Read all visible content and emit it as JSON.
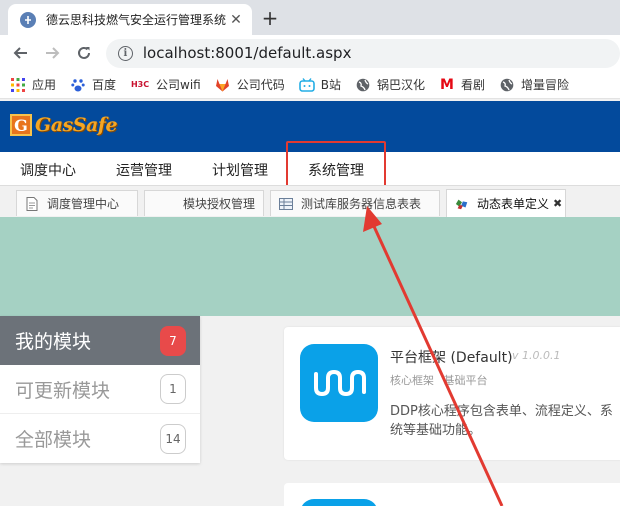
{
  "browser": {
    "tab_title": "德云思科技燃气安全运行管理系统",
    "url": "localhost:8001/default.aspx"
  },
  "bookmarks": [
    {
      "label": "应用",
      "icon": "apps-grid-icon"
    },
    {
      "label": "百度",
      "icon": "baidu-paw-icon"
    },
    {
      "label": "公司wifi",
      "icon": "h3c-logo-icon",
      "icon_text": "H3C"
    },
    {
      "label": "公司代码",
      "icon": "gitlab-icon"
    },
    {
      "label": "B站",
      "icon": "bilibili-tv-icon"
    },
    {
      "label": "锅巴汉化",
      "icon": "globe-icon"
    },
    {
      "label": "看剧",
      "icon": "m-logo-icon",
      "icon_text": "M"
    },
    {
      "label": "增量冒险",
      "icon": "globe-icon"
    }
  ],
  "app": {
    "logo_letter": "G",
    "logo_text": "GasSafe"
  },
  "main_menu": [
    "调度中心",
    "运营管理",
    "计划管理",
    "系统管理"
  ],
  "sub_tabs": [
    {
      "label": "调度管理中心"
    },
    {
      "label": "模块授权管理"
    },
    {
      "label": "测试库服务器信息表表"
    },
    {
      "label": "动态表单定义",
      "close": "✖"
    }
  ],
  "side_menu": [
    {
      "label": "我的模块",
      "count": "7"
    },
    {
      "label": "可更新模块",
      "count": "1"
    },
    {
      "label": "全部模块",
      "count": "14"
    }
  ],
  "module_card": {
    "title": "平台框架 (Default)",
    "version": "v 1.0.0.1",
    "tags": [
      "核心框架",
      "基础平台"
    ],
    "description": "DDP核心程序包含表单、流程定义、系统等基础功能。"
  },
  "colors": {
    "header_blue": "#034a9c",
    "banner_teal": "#a5d1c3",
    "badge_red": "#e84a4a",
    "app_icon_blue": "#0aa1e8",
    "annotation_red": "#e23a31"
  }
}
